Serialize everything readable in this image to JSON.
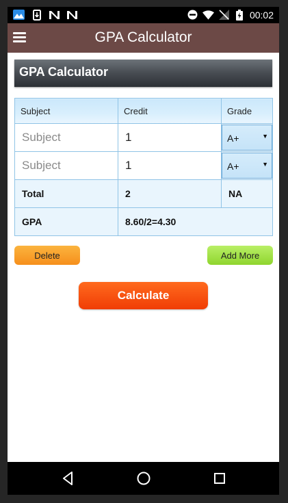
{
  "status_bar": {
    "time": "00:02",
    "left_icons": [
      "gallery-icon",
      "download-icon",
      "n-app-icon",
      "n-app-icon"
    ],
    "right_icons": [
      "do-not-disturb-icon",
      "wifi-icon",
      "no-signal-icon",
      "battery-charging-icon"
    ]
  },
  "app_bar": {
    "title": "GPA Calculator",
    "color": "#6c4946",
    "menu_icon": "hamburger-menu-icon"
  },
  "section_header": "GPA Calculator",
  "table": {
    "headers": [
      "Subject",
      "Credit",
      "Grade"
    ],
    "rows": [
      {
        "subject_placeholder": "Subject",
        "subject_value": "",
        "credit": "1",
        "grade": "A+"
      },
      {
        "subject_placeholder": "Subject",
        "subject_value": "",
        "credit": "1",
        "grade": "A+"
      }
    ],
    "total": {
      "label": "Total",
      "credit": "2",
      "grade": "NA"
    },
    "gpa": {
      "label": "GPA",
      "value": "8.60/2=4.30"
    }
  },
  "buttons": {
    "delete": "Delete",
    "add_more": "Add More",
    "calculate": "Calculate"
  },
  "nav_bar": {
    "icons": [
      "back-icon",
      "home-icon",
      "recents-icon"
    ]
  }
}
